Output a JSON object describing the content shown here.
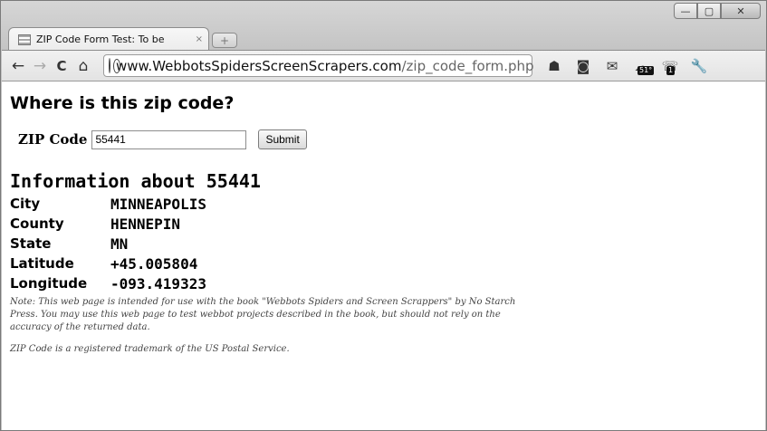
{
  "window": {
    "controls": {
      "minimize": "—",
      "maximize": "▢",
      "close": "✕"
    }
  },
  "tab": {
    "title": "ZIP Code Form Test: To be",
    "close": "×",
    "new_tab": "+"
  },
  "toolbar": {
    "back": "←",
    "forward": "→",
    "reload": "C",
    "home": "⌂",
    "url_domain": "www.WebbotsSpidersScreenScrapers.com",
    "url_path": "/zip_code_form.php",
    "badge_weather": "51°",
    "badge_phone": "1"
  },
  "page": {
    "heading": "Where is this zip code?",
    "form": {
      "label": "ZIP Code",
      "value": "55441",
      "submit": "Submit"
    },
    "info_title": "Information about 55441",
    "info": [
      {
        "key": "City",
        "value": "MINNEAPOLIS"
      },
      {
        "key": "County",
        "value": "HENNEPIN"
      },
      {
        "key": "State",
        "value": "MN"
      },
      {
        "key": "Latitude",
        "value": "+45.005804"
      },
      {
        "key": "Longitude",
        "value": "-093.419323"
      }
    ],
    "note": "Note: This web page is intended for use with the book \"Webbots Spiders and Screen Scrappers\" by No Starch Press. You may use this web page to test webbot projects described in the book, but should not rely on the accuracy of the returned data.",
    "trademark": "ZIP Code is a registered trademark of the US Postal Service."
  }
}
